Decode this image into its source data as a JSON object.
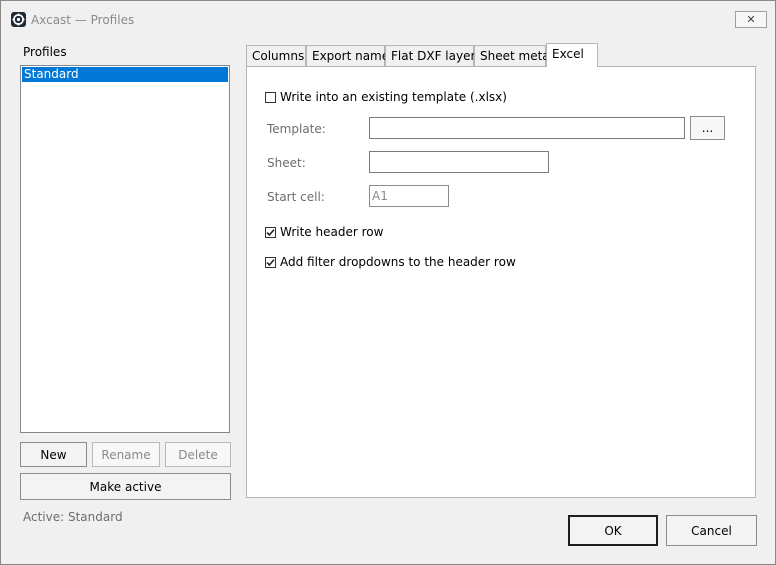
{
  "window": {
    "title": "Axcast — Profiles",
    "close_glyph": "✕"
  },
  "profiles": {
    "label": "Profiles",
    "items": [
      "Standard"
    ],
    "buttons": {
      "new": "New",
      "rename": "Rename",
      "delete": "Delete",
      "make_active": "Make active"
    },
    "active_text": "Active: Standard"
  },
  "tabs": [
    "Columns",
    "Export name",
    "Flat DXF layers",
    "Sheet metal",
    "Excel"
  ],
  "selected_tab": "Excel",
  "excel": {
    "write_template_label": "Write into an existing template (.xlsx)",
    "write_template_checked": false,
    "template_label": "Template:",
    "template_value": "",
    "browse_label": "...",
    "sheet_label": "Sheet:",
    "sheet_value": "",
    "start_cell_label": "Start cell:",
    "start_cell_value": "A1",
    "header_row_label": "Write header row",
    "header_row_checked": true,
    "filter_label": "Add filter dropdowns to the header row",
    "filter_checked": true
  },
  "footer": {
    "ok": "OK",
    "cancel": "Cancel"
  }
}
